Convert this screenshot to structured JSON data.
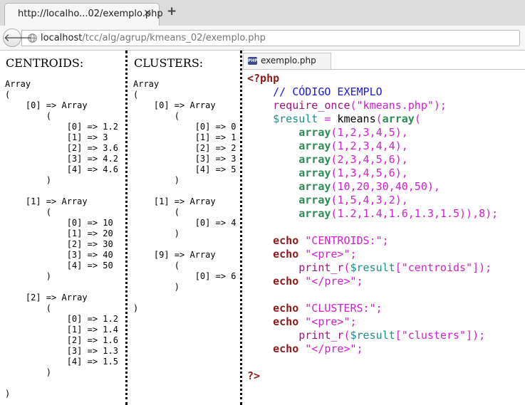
{
  "tab": {
    "title": "http://localho...02/exemplo.php",
    "close": "✕",
    "new_tab": "+"
  },
  "nav": {
    "back": "🡐",
    "url_host": "localhost",
    "url_path": "/tcc/alg/agrup/kmeans_02/exemplo.php"
  },
  "centroids": {
    "heading": "CENTROIDS:",
    "dump": "Array\n(\n    [0] => Array\n        (\n            [0] => 1.2\n            [1] => 3\n            [2] => 3.6\n            [3] => 4.2\n            [4] => 4.6\n        )\n\n    [1] => Array\n        (\n            [0] => 10\n            [1] => 20\n            [2] => 30\n            [3] => 40\n            [4] => 50\n        )\n\n    [2] => Array\n        (\n            [0] => 1.2\n            [1] => 1.4\n            [2] => 1.6\n            [3] => 1.3\n            [4] => 1.5\n        )\n\n)"
  },
  "clusters": {
    "heading": "CLUSTERS:",
    "dump": "Array\n(\n    [0] => Array\n        (\n            [0] => 0\n            [1] => 1\n            [2] => 2\n            [3] => 3\n            [4] => 5\n        )\n\n    [1] => Array\n        (\n            [0] => 4\n        )\n\n    [9] => Array\n        (\n            [0] => 6\n        )\n\n)"
  },
  "source": {
    "tab_title": "exemplo.php",
    "icon_label": "PHP",
    "lines": [
      [
        [
          "kw",
          "<?php"
        ]
      ],
      [
        [
          "id",
          "    "
        ],
        [
          "cm",
          "// CÓDIGO EXEMPLO"
        ]
      ],
      [
        [
          "id",
          "    "
        ],
        [
          "fn",
          "require_once"
        ],
        [
          "sy",
          "("
        ],
        [
          "st",
          "\"kmeans.php\""
        ],
        [
          "sy",
          ");"
        ]
      ],
      [
        [
          "id",
          "    "
        ],
        [
          "vr",
          "$result"
        ],
        [
          "id",
          " "
        ],
        [
          "sy",
          "="
        ],
        [
          "id",
          " kmeans"
        ],
        [
          "sy",
          "("
        ],
        [
          "ar",
          "array"
        ],
        [
          "sy",
          "("
        ]
      ],
      [
        [
          "id",
          "        "
        ],
        [
          "ar",
          "array"
        ],
        [
          "sy",
          "("
        ],
        [
          "nm",
          "1,2,3,4,5"
        ],
        [
          "sy",
          "),"
        ]
      ],
      [
        [
          "id",
          "        "
        ],
        [
          "ar",
          "array"
        ],
        [
          "sy",
          "("
        ],
        [
          "nm",
          "1,2,3,4,4"
        ],
        [
          "sy",
          "),"
        ]
      ],
      [
        [
          "id",
          "        "
        ],
        [
          "ar",
          "array"
        ],
        [
          "sy",
          "("
        ],
        [
          "nm",
          "2,3,4,5,6"
        ],
        [
          "sy",
          "),"
        ]
      ],
      [
        [
          "id",
          "        "
        ],
        [
          "ar",
          "array"
        ],
        [
          "sy",
          "("
        ],
        [
          "nm",
          "1,3,4,5,6"
        ],
        [
          "sy",
          "),"
        ]
      ],
      [
        [
          "id",
          "        "
        ],
        [
          "ar",
          "array"
        ],
        [
          "sy",
          "("
        ],
        [
          "nm",
          "10,20,30,40,50"
        ],
        [
          "sy",
          "),"
        ]
      ],
      [
        [
          "id",
          "        "
        ],
        [
          "ar",
          "array"
        ],
        [
          "sy",
          "("
        ],
        [
          "nm",
          "1,5,4,3,2"
        ],
        [
          "sy",
          "),"
        ]
      ],
      [
        [
          "id",
          "        "
        ],
        [
          "ar",
          "array"
        ],
        [
          "sy",
          "("
        ],
        [
          "nm",
          "1.2,1.4,1.6,1.3,1.5"
        ],
        [
          "sy",
          ")),"
        ],
        [
          "nm",
          "8"
        ],
        [
          "sy",
          ");"
        ]
      ],
      [],
      [
        [
          "id",
          "    "
        ],
        [
          "kw",
          "echo"
        ],
        [
          "id",
          " "
        ],
        [
          "st",
          "\"CENTROIDS:\""
        ],
        [
          "sy",
          ";"
        ]
      ],
      [
        [
          "id",
          "    "
        ],
        [
          "kw",
          "echo"
        ],
        [
          "id",
          " "
        ],
        [
          "st",
          "\"<pre>\""
        ],
        [
          "sy",
          ";"
        ]
      ],
      [
        [
          "id",
          "        "
        ],
        [
          "fn",
          "print_r"
        ],
        [
          "sy",
          "("
        ],
        [
          "vr",
          "$result"
        ],
        [
          "sy",
          "["
        ],
        [
          "st",
          "\"centroids\""
        ],
        [
          "sy",
          "]);"
        ]
      ],
      [
        [
          "id",
          "    "
        ],
        [
          "kw",
          "echo"
        ],
        [
          "id",
          " "
        ],
        [
          "st",
          "\"</pre>\""
        ],
        [
          "sy",
          ";"
        ]
      ],
      [],
      [
        [
          "id",
          "    "
        ],
        [
          "kw",
          "echo"
        ],
        [
          "id",
          " "
        ],
        [
          "st",
          "\"CLUSTERS:\""
        ],
        [
          "sy",
          ";"
        ]
      ],
      [
        [
          "id",
          "    "
        ],
        [
          "kw",
          "echo"
        ],
        [
          "id",
          " "
        ],
        [
          "st",
          "\"<pre>\""
        ],
        [
          "sy",
          ";"
        ]
      ],
      [
        [
          "id",
          "        "
        ],
        [
          "fn",
          "print_r"
        ],
        [
          "sy",
          "("
        ],
        [
          "vr",
          "$result"
        ],
        [
          "sy",
          "["
        ],
        [
          "st",
          "\"clusters\""
        ],
        [
          "sy",
          "]);"
        ]
      ],
      [
        [
          "id",
          "    "
        ],
        [
          "kw",
          "echo"
        ],
        [
          "id",
          " "
        ],
        [
          "st",
          "\"</pre>\""
        ],
        [
          "sy",
          ";"
        ]
      ],
      [],
      [
        [
          "kw",
          "?>"
        ]
      ]
    ]
  }
}
